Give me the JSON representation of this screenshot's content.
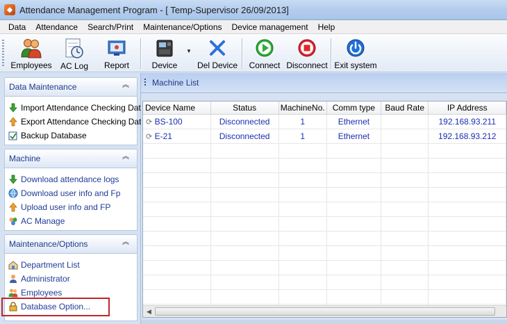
{
  "window": {
    "title": "Attendance Management Program - [ Temp-Supervisor 26/09/2013]"
  },
  "menu": [
    "Data",
    "Attendance",
    "Search/Print",
    "Maintenance/Options",
    "Device management",
    "Help"
  ],
  "toolbar": {
    "employees": "Employees",
    "ac_log": "AC Log",
    "report": "Report",
    "device": "Device",
    "del_device": "Del Device",
    "connect": "Connect",
    "disconnect": "Disconnect",
    "exit_system": "Exit system"
  },
  "sidebar": {
    "data_maintenance": {
      "title": "Data Maintenance",
      "items": [
        "Import Attendance Checking Data",
        "Export Attendance Checking Data",
        "Backup Database"
      ]
    },
    "machine": {
      "title": "Machine",
      "items": [
        "Download attendance logs",
        "Download user info and Fp",
        "Upload user info and FP",
        "AC Manage"
      ]
    },
    "maintenance_options": {
      "title": "Maintenance/Options",
      "items": [
        "Department List",
        "Administrator",
        "Employees",
        "Database Option..."
      ]
    }
  },
  "machine_list": {
    "title": "Machine List",
    "columns": [
      "Device Name",
      "Status",
      "MachineNo.",
      "Comm type",
      "Baud Rate",
      "IP Address"
    ],
    "rows": [
      {
        "name": "BS-100",
        "status": "Disconnected",
        "machine_no": "1",
        "comm_type": "Ethernet",
        "baud_rate": "",
        "ip": "192.168.93.211"
      },
      {
        "name": "E-21",
        "status": "Disconnected",
        "machine_no": "1",
        "comm_type": "Ethernet",
        "baud_rate": "",
        "ip": "192.168.93.212"
      }
    ]
  },
  "colors": {
    "accent_blue": "#1e3a8a",
    "row_text": "#1a2fb0",
    "highlight": "#c0262b"
  }
}
